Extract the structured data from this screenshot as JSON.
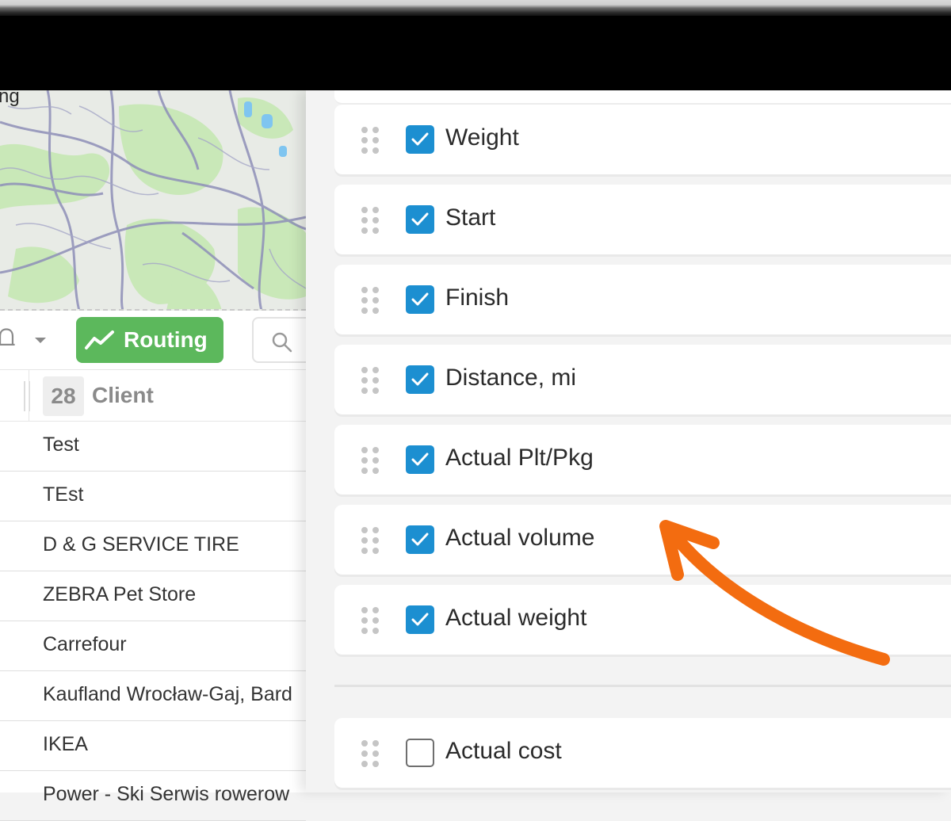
{
  "map": {
    "partial_label": "ng"
  },
  "toolbar": {
    "routing_label": "Routing",
    "icons": [
      "bell-icon",
      "chevron-down-icon",
      "routing-chart-icon",
      "search-icon"
    ],
    "routing_color": "#5cb85c"
  },
  "table": {
    "count": "28",
    "column_label": "Client",
    "rows": [
      "Test",
      "TEst",
      "D & G SERVICE TIRE",
      "ZEBRA Pet Store",
      "Carrefour",
      "Kaufland Wrocław-Gaj, Bard",
      "IKEA",
      "Power - Ski Serwis rowerow"
    ]
  },
  "columns_panel": {
    "checkbox_color": "#1c8fd1",
    "checked_items": [
      {
        "label": "Weight",
        "checked": true
      },
      {
        "label": "Start",
        "checked": true
      },
      {
        "label": "Finish",
        "checked": true
      },
      {
        "label": "Distance, mi",
        "checked": true
      },
      {
        "label": "Actual Plt/Pkg",
        "checked": true
      },
      {
        "label": "Actual volume",
        "checked": true
      },
      {
        "label": "Actual weight",
        "checked": true
      }
    ],
    "unchecked_items": [
      {
        "label": "Actual cost",
        "checked": false
      }
    ]
  },
  "annotation": {
    "arrow_color": "#f36c10"
  }
}
